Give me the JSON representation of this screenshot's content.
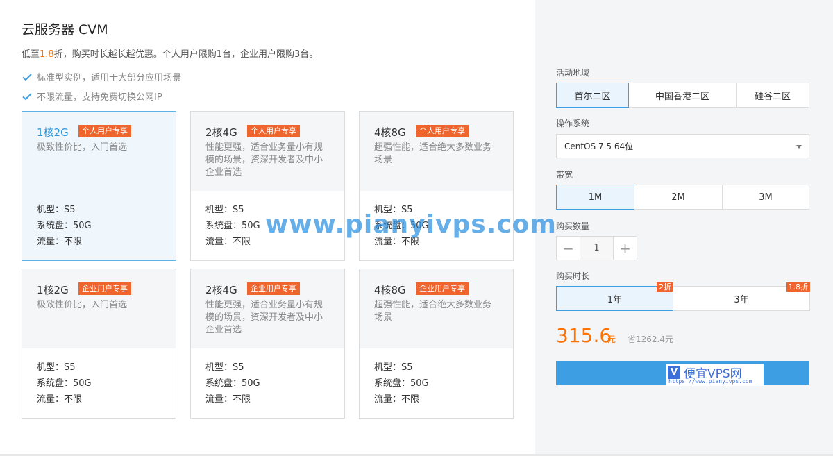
{
  "product": {
    "title": "云服务器 CVM",
    "promo_prefix": "低至",
    "promo_discount": "1.8",
    "promo_suffix": "折，购买时长越长越优惠。个人用户限购1台，企业用户限购3台。",
    "features": [
      "标准型实例，适用于大部分应用场景",
      "不限流量，支持免费切换公网IP"
    ]
  },
  "cards": [
    {
      "spec": "1核2G",
      "tag": "个人用户专享",
      "desc": "极致性价比，入门首选",
      "model": "机型：S5",
      "disk": "系统盘：50G",
      "traffic": "流量：不限",
      "selected": true
    },
    {
      "spec": "2核4G",
      "tag": "个人用户专享",
      "desc": "性能更强，适合业务量小有规模的场景，资深开发者及中小企业首选",
      "model": "机型：S5",
      "disk": "系统盘：50G",
      "traffic": "流量：不限",
      "selected": false
    },
    {
      "spec": "4核8G",
      "tag": "个人用户专享",
      "desc": "超强性能，适合绝大多数业务场景",
      "model": "机型：S5",
      "disk": "系统盘：50G",
      "traffic": "流量：不限",
      "selected": false
    },
    {
      "spec": "1核2G",
      "tag": "企业用户专享",
      "desc": "极致性价比，入门首选",
      "model": "机型：S5",
      "disk": "系统盘：50G",
      "traffic": "流量：不限",
      "selected": false
    },
    {
      "spec": "2核4G",
      "tag": "企业用户专享",
      "desc": "性能更强，适合业务量小有规模的场景，资深开发者及中小企业首选",
      "model": "机型：S5",
      "disk": "系统盘：50G",
      "traffic": "流量：不限",
      "selected": false
    },
    {
      "spec": "4核8G",
      "tag": "企业用户专享",
      "desc": "超强性能，适合绝大多数业务场景",
      "model": "机型：S5",
      "disk": "系统盘：50G",
      "traffic": "流量：不限",
      "selected": false
    }
  ],
  "config": {
    "region_label": "活动地域",
    "regions": [
      "首尔二区",
      "中国香港二区",
      "硅谷二区"
    ],
    "os_label": "操作系统",
    "os_value": "CentOS 7.5 64位",
    "bandwidth_label": "带宽",
    "bandwidths": [
      "1M",
      "2M",
      "3M"
    ],
    "quantity_label": "购买数量",
    "quantity": "1",
    "minus": "−",
    "plus": "+",
    "duration_label": "购买时长",
    "durations": [
      {
        "label": "1年",
        "discount": "2折"
      },
      {
        "label": "3年",
        "discount": "1.8折"
      }
    ],
    "price": "315.6",
    "price_unit": "元",
    "save": "省1262.4元"
  },
  "logo": {
    "mark": "V",
    "text": "便宜VPS网",
    "url": "https://www.pianyivps.com"
  },
  "watermark": "www.pianyivps.com",
  "colors": {
    "accent": "#3d9ee4",
    "tag": "#f0652e",
    "price": "#ff7200"
  },
  "icons": {
    "feature": "check-icon",
    "select": "caret-down-icon"
  }
}
